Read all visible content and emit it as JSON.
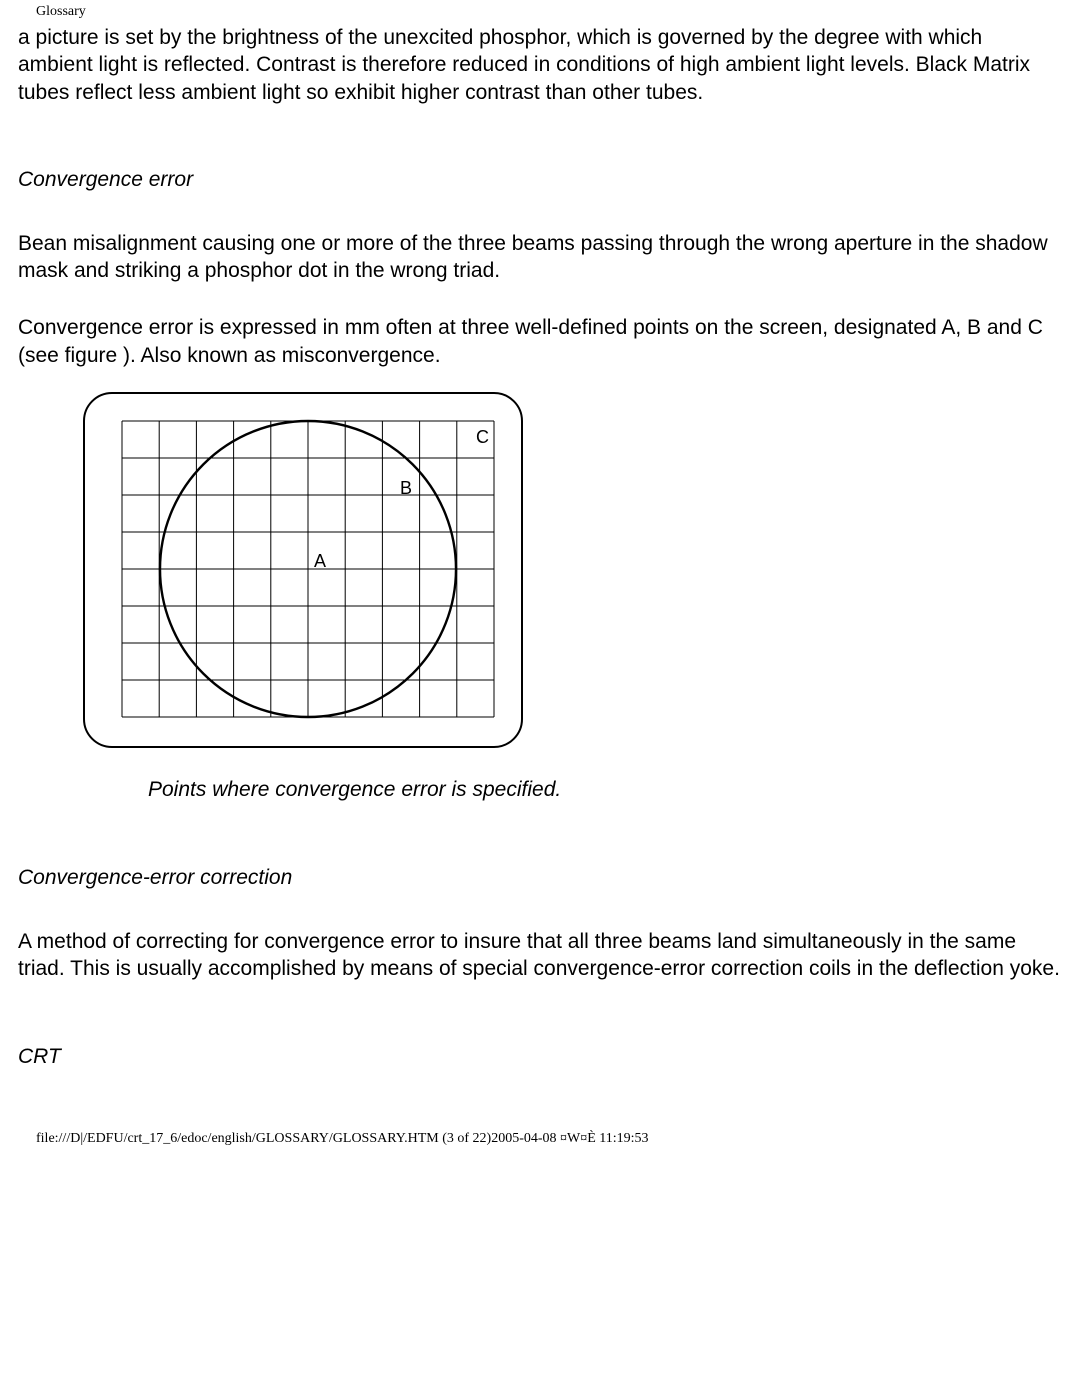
{
  "header": {
    "title": "Glossary"
  },
  "body": {
    "intro_para": "a picture is set by the brightness of the unexcited phosphor, which is governed by the degree with which ambient light is reflected. Contrast is therefore reduced in conditions of high ambient light levels. Black Matrix tubes reflect less ambient light so exhibit higher contrast than other tubes.",
    "conv_error": {
      "heading": "Convergence error",
      "para1": "Bean misalignment causing one or more of the three beams passing through the wrong aperture in the shadow mask and striking a phosphor dot in the wrong triad.",
      "para2": "Convergence error is expressed in mm often at three well-defined points on the screen, designated A, B and C (see figure ). Also known as misconvergence.",
      "caption": "Points where convergence error is specified."
    },
    "conv_corr": {
      "heading": "Convergence-error correction",
      "para": "A method of correcting for convergence error to insure that all three beams land simultaneously in the same triad. This is usually accomplished by means of special convergence-error correction coils in the deflection yoke."
    },
    "crt": {
      "heading": "CRT"
    }
  },
  "figure": {
    "labels": {
      "A": "A",
      "B": "B",
      "C": "C"
    }
  },
  "footer": {
    "text": "file:///D|/EDFU/crt_17_6/edoc/english/GLOSSARY/GLOSSARY.HTM (3 of 22)2005-04-08 ¤W¤È 11:19:53"
  }
}
